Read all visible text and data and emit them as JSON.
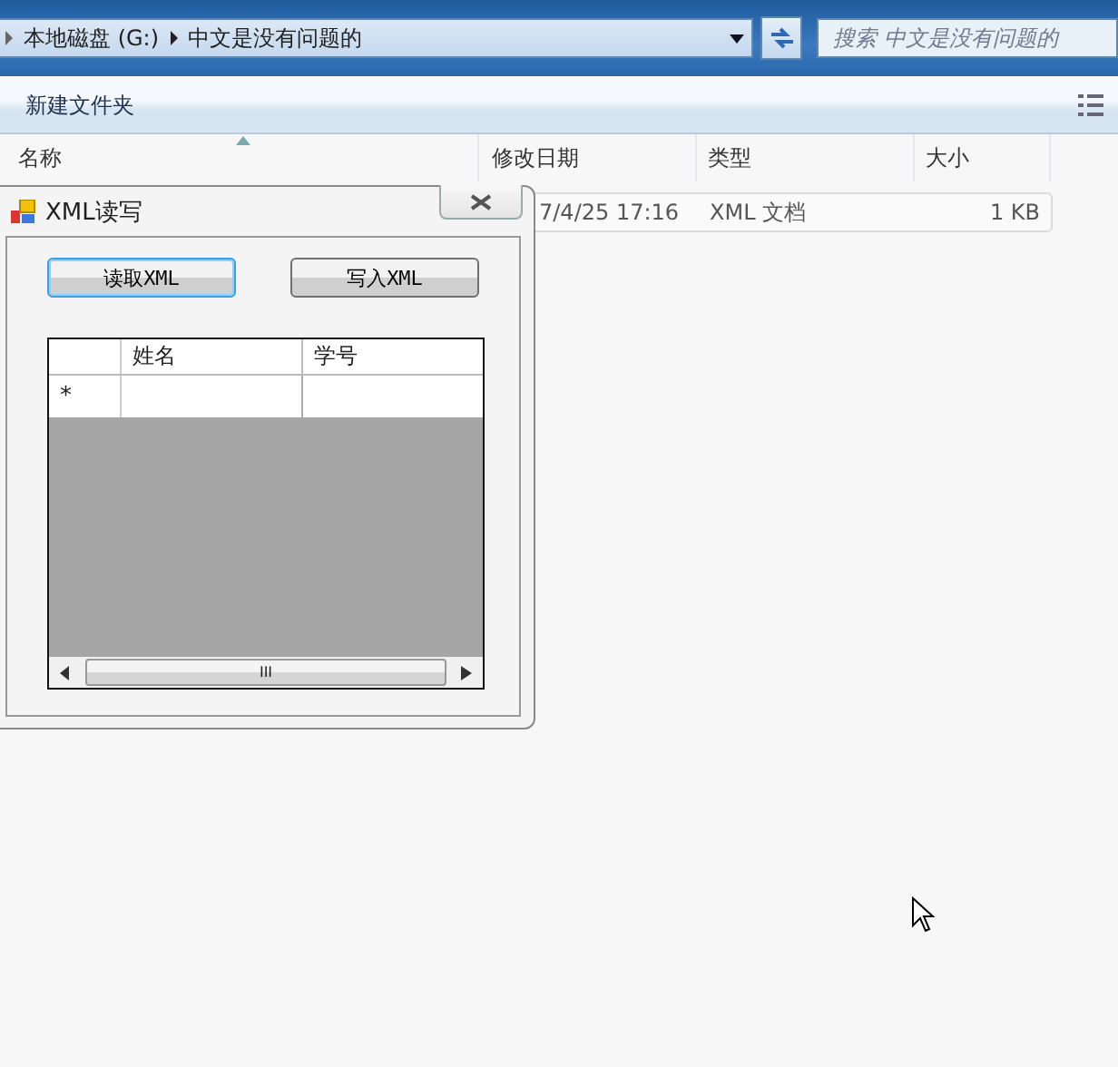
{
  "address_bar": {
    "path": [
      "本地磁盘 (G:)",
      "中文是没有问题的"
    ]
  },
  "search": {
    "placeholder": "搜索 中文是没有问题的"
  },
  "toolbar": {
    "buttons": [
      "新建文件夹"
    ]
  },
  "columns": [
    "名称",
    "修改日期",
    "类型",
    "大小"
  ],
  "files": [
    {
      "modified": "7/4/25 17:16",
      "type": "XML 文档",
      "size": "1 KB"
    }
  ],
  "dialog": {
    "title": "XML读写",
    "buttons": [
      {
        "label": "读取XML",
        "focused": true
      },
      {
        "label": "写入XML",
        "focused": false
      }
    ],
    "grid": {
      "columns": [
        "姓名",
        "学号"
      ],
      "new_row_marker": "*",
      "scroll_thumb": "III"
    }
  }
}
